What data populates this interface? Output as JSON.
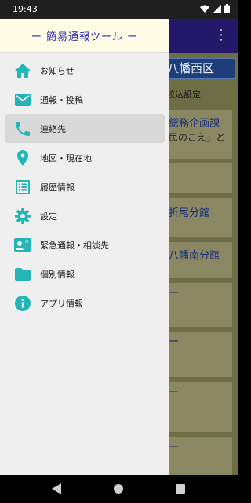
{
  "status_bar": {
    "time": "19:43"
  },
  "background": {
    "district": "八幡西区",
    "filter_label": "絞込設定",
    "cards": [
      {
        "title": "総務企画課",
        "subtitle": "民のこえ」と"
      },
      {
        "title": ""
      },
      {
        "title": "折尾分館"
      },
      {
        "title": "八幡南分館"
      },
      {
        "title": "ー"
      },
      {
        "title": "ー"
      },
      {
        "title": "ー"
      },
      {
        "title": "ー"
      }
    ]
  },
  "drawer": {
    "title": "ー 簡易通報ツール ー",
    "items": [
      {
        "label": "お知らせ",
        "icon": "home-icon"
      },
      {
        "label": "通報・投稿",
        "icon": "mail-icon"
      },
      {
        "label": "連絡先",
        "icon": "phone-icon"
      },
      {
        "label": "地図・現在地",
        "icon": "location-pin-icon"
      },
      {
        "label": "履歴情報",
        "icon": "list-icon"
      },
      {
        "label": "設定",
        "icon": "gear-icon"
      },
      {
        "label": "緊急通報・相談先",
        "icon": "contact-card-icon"
      },
      {
        "label": "個別情報",
        "icon": "folder-icon"
      },
      {
        "label": "アプリ情報",
        "icon": "info-icon"
      }
    ],
    "active_index": 2
  },
  "colors": {
    "accent": "#26b5b7",
    "title": "#2b2bb8",
    "appbar": "#23186a"
  }
}
